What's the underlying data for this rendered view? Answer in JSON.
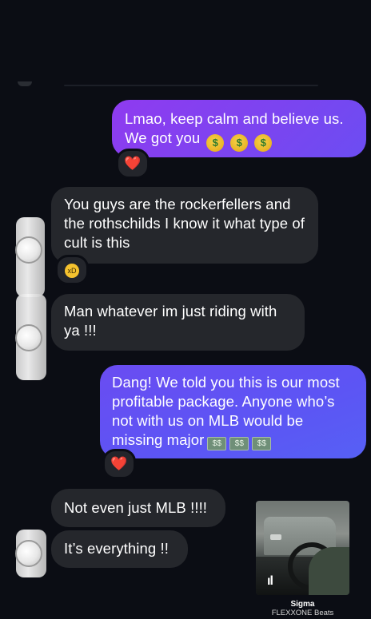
{
  "messages": [
    {
      "id": "m1",
      "direction": "outgoing",
      "text": "Lmao, keep calm and believe us. We got you",
      "inline_emojis": [
        "money-mouth-face",
        "money-mouth-face",
        "money-mouth-face"
      ],
      "reaction": "❤️"
    },
    {
      "id": "m2",
      "direction": "incoming",
      "text": "You guys are the rockerfellers and the rothschilds I know it what type of cult is this",
      "reaction": "😂"
    },
    {
      "id": "m3",
      "direction": "incoming",
      "text": "Man whatever im just riding with ya !!!"
    },
    {
      "id": "m4",
      "direction": "outgoing",
      "text": "Dang! We told you this is our most profitable package. Anyone who’s not with us on MLB would be missing major",
      "inline_emojis": [
        "money-with-wings",
        "money-with-wings",
        "money-with-wings"
      ],
      "reaction": "❤️"
    },
    {
      "id": "m5",
      "direction": "incoming",
      "text": "Not even just MLB !!!!"
    },
    {
      "id": "m6",
      "direction": "incoming",
      "text": "It’s everything !!"
    }
  ],
  "shared_media": {
    "title": "Sigma",
    "artist": "FLEXXONE Beats",
    "icon": "audio-waveform-icon"
  },
  "colors": {
    "background": "#0b0d14",
    "incoming_bubble": "#25272c",
    "outgoing_bubble_start": "#8f3bf0",
    "outgoing_bubble_end": "#5660f5",
    "heart": "#ff2f3d"
  }
}
